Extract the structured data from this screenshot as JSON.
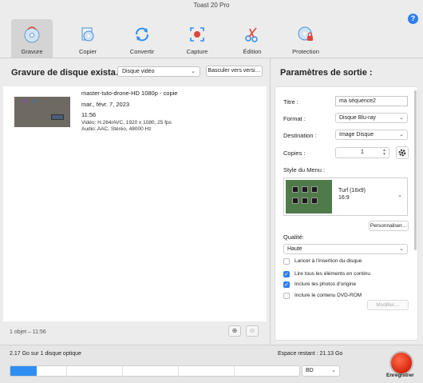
{
  "window": {
    "title": "Toast 20 Pro"
  },
  "toolbar": {
    "items": [
      {
        "label": "Gravure",
        "icon": "disc-burn-icon",
        "active": true
      },
      {
        "label": "Copier",
        "icon": "copy-disc-icon",
        "active": false
      },
      {
        "label": "Convertir",
        "icon": "convert-icon",
        "active": false
      },
      {
        "label": "Capture",
        "icon": "capture-icon",
        "active": false
      },
      {
        "label": "Édition",
        "icon": "edit-scissors-icon",
        "active": false
      },
      {
        "label": "Protection",
        "icon": "protection-icon",
        "active": false
      }
    ],
    "help_label": "?"
  },
  "left": {
    "title": "Gravure de disque exista…",
    "disc_type": "Disque vidéo",
    "switch_button": "Basculer vers versi…",
    "items": [
      {
        "name": "master-tuto-drone-HD 1080p - copie",
        "date": "mar., févr. 7, 2023",
        "time": "11:56",
        "video": "Vidéo: H.264/AVC, 1920 x 1080, 25 fps",
        "audio": "Audio: AAC, Stéréo, 48000 Hz"
      }
    ],
    "footer": "1 objet – 11:56"
  },
  "right": {
    "title": "Paramètres de sortie :",
    "fields": {
      "titre_label": "Titre :",
      "titre_value": "ma séquence2",
      "format_label": "Format :",
      "format_value": "Disque Blu-ray",
      "destination_label": "Destination :",
      "destination_value": "Image Disque",
      "copies_label": "Copies :",
      "copies_value": "1"
    },
    "menu_style_label": "Style du Menu :",
    "menu_style": {
      "name": "Turf (16x9)",
      "ratio": "16:9"
    },
    "personnaliser_label": "Personnaliser…",
    "quality_label": "Qualité:",
    "quality_value": "Haute",
    "options": [
      {
        "label": "Lancer à l'insertion du disque",
        "checked": false
      },
      {
        "label": "Lire tous les éléments en continu",
        "checked": true
      },
      {
        "label": "Inclure les photos d'origine",
        "checked": true
      },
      {
        "label": "Inclure le contenu DVD-ROM",
        "checked": false
      }
    ],
    "modifier_label": "Modifier…"
  },
  "bottom": {
    "usage": "2.17 Go sur 1 disque optique",
    "remaining": "Espace restant : 21.13 Go",
    "progress_fraction": 0.09,
    "media": "BD",
    "record_label": "Enregistrer"
  },
  "colors": {
    "accent": "#2f7ff0",
    "record": "#d8260e",
    "progress": "#2f8ff0"
  }
}
